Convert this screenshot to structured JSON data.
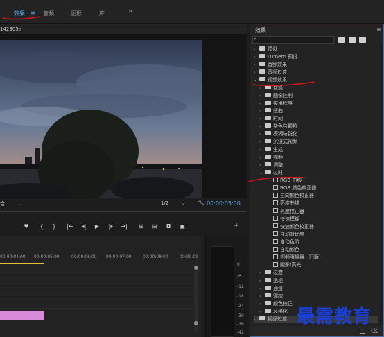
{
  "topbar": {
    "tabs": [
      {
        "label": "效果",
        "active": true
      },
      {
        "label": "≡"
      },
      {
        "label": "音频"
      },
      {
        "label": "图形"
      },
      {
        "label": "库"
      }
    ],
    "overflow": "»"
  },
  "program": {
    "sequence": "142305",
    "menu": "≡",
    "fit": "合",
    "fit_arrow": "⌄",
    "quality": "1/2",
    "quality_arrow": "⌄",
    "timecode": "00:00:05:00"
  },
  "transport": {
    "buttons": [
      {
        "name": "add-marker-button",
        "glyph": "♥"
      },
      {
        "name": "mark-in-button",
        "glyph": "{"
      },
      {
        "name": "mark-out-button",
        "glyph": "}"
      },
      {
        "name": "go-to-in-button",
        "glyph": "|←"
      },
      {
        "name": "step-back-button",
        "glyph": "◂|"
      },
      {
        "name": "play-button",
        "glyph": "▶"
      },
      {
        "name": "step-forward-button",
        "glyph": "|▸"
      },
      {
        "name": "go-to-out-button",
        "glyph": "→|"
      },
      {
        "name": "lift-button",
        "glyph": "⊞"
      },
      {
        "name": "extract-button",
        "glyph": "⊟"
      },
      {
        "name": "export-frame-button",
        "glyph": "◘"
      },
      {
        "name": "button-editor-button",
        "glyph": "▣"
      },
      {
        "name": "add-button",
        "glyph": "+"
      }
    ]
  },
  "timeline": {
    "ticks": [
      "00:00:04:00",
      "00:00:05:00",
      "00:00:06:00",
      "00:00:07:00",
      "00:00:08:00",
      "00:00:09"
    ]
  },
  "meters": {
    "labels": [
      "0",
      "-6",
      "-12",
      "-18",
      "-24",
      "-30",
      "-36",
      "-42"
    ]
  },
  "effects": {
    "title": "效果",
    "menu": "≡",
    "search_icon": "⌕",
    "tree": [
      {
        "label": "预设",
        "depth": 0,
        "expanded": false,
        "folder": true
      },
      {
        "label": "Lumetri 预设",
        "depth": 0,
        "expanded": false,
        "folder": true
      },
      {
        "label": "音频效果",
        "depth": 0,
        "expanded": false,
        "folder": true
      },
      {
        "label": "音频过渡",
        "depth": 0,
        "expanded": false,
        "folder": true
      },
      {
        "label": "视频效果",
        "depth": 0,
        "expanded": true,
        "folder": true
      },
      {
        "label": "变换",
        "depth": 1,
        "expanded": false,
        "folder": true
      },
      {
        "label": "图像控制",
        "depth": 1,
        "expanded": false,
        "folder": true
      },
      {
        "label": "实用程序",
        "depth": 1,
        "expanded": false,
        "folder": true
      },
      {
        "label": "扭曲",
        "depth": 1,
        "expanded": false,
        "folder": true
      },
      {
        "label": "时间",
        "depth": 1,
        "expanded": false,
        "folder": true
      },
      {
        "label": "杂色与颗粒",
        "depth": 1,
        "expanded": false,
        "folder": true
      },
      {
        "label": "模糊与锐化",
        "depth": 1,
        "expanded": false,
        "folder": true
      },
      {
        "label": "沉浸式视频",
        "depth": 1,
        "expanded": false,
        "folder": true
      },
      {
        "label": "生成",
        "depth": 1,
        "expanded": false,
        "folder": true
      },
      {
        "label": "视频",
        "depth": 1,
        "expanded": false,
        "folder": true
      },
      {
        "label": "调整",
        "depth": 1,
        "expanded": false,
        "folder": true
      },
      {
        "label": "过时",
        "depth": 1,
        "expanded": true,
        "folder": true
      },
      {
        "label": "RGB 曲线",
        "depth": 2,
        "folder": false
      },
      {
        "label": "RGB 颜色校正器",
        "depth": 2,
        "folder": false
      },
      {
        "label": "三向颜色校正器",
        "depth": 2,
        "folder": false
      },
      {
        "label": "亮度曲线",
        "depth": 2,
        "folder": false
      },
      {
        "label": "亮度校正器",
        "depth": 2,
        "folder": false
      },
      {
        "label": "快速模糊",
        "depth": 2,
        "folder": false
      },
      {
        "label": "快速颜色校正器",
        "depth": 2,
        "folder": false
      },
      {
        "label": "自动对比度",
        "depth": 2,
        "folder": false
      },
      {
        "label": "自动色阶",
        "depth": 2,
        "folder": false
      },
      {
        "label": "自动颜色",
        "depth": 2,
        "folder": false
      },
      {
        "label": "视频限幅器（旧版）",
        "depth": 2,
        "folder": false
      },
      {
        "label": "阴影/高光",
        "depth": 2,
        "folder": false
      },
      {
        "label": "过渡",
        "depth": 1,
        "expanded": false,
        "folder": true
      },
      {
        "label": "透视",
        "depth": 1,
        "expanded": false,
        "folder": true
      },
      {
        "label": "通道",
        "depth": 1,
        "expanded": false,
        "folder": true
      },
      {
        "label": "键控",
        "depth": 1,
        "expanded": false,
        "folder": true
      },
      {
        "label": "颜色校正",
        "depth": 1,
        "expanded": false,
        "folder": true
      },
      {
        "label": "风格化",
        "depth": 1,
        "expanded": false,
        "folder": true
      },
      {
        "label": "视频过渡",
        "depth": 0,
        "expanded": false,
        "folder": true
      }
    ]
  },
  "watermark": "最需教育",
  "colors": {
    "accent": "#5ea8ff",
    "annotation": "#d6141c",
    "clip": "#d889d8",
    "playhead": "#e0c233",
    "watermark": "#1a3fd8"
  }
}
